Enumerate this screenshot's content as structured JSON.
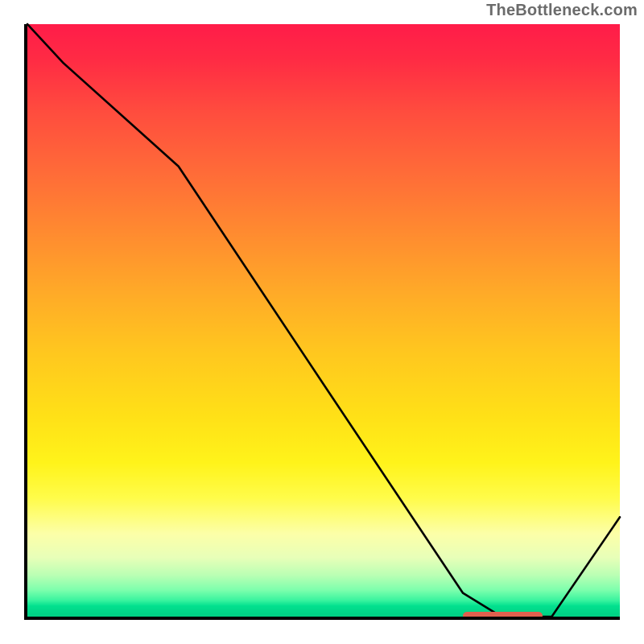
{
  "watermark": "TheBottleneck.com",
  "chart_data": {
    "type": "line",
    "title": "",
    "xlabel": "",
    "ylabel": "",
    "x": [
      0.0,
      0.06,
      0.255,
      0.5,
      0.735,
      0.8,
      0.885,
      1.0
    ],
    "values": [
      1.0,
      0.935,
      0.76,
      0.392,
      0.04,
      0.0,
      0.0,
      0.168
    ],
    "xlim": [
      0,
      1
    ],
    "ylim": [
      0,
      1
    ],
    "optimal_band": {
      "start": 0.735,
      "end": 0.87,
      "y": 0.0
    },
    "gradient": {
      "top_color": "#ff1c49",
      "mid_color": "#ffe017",
      "bottom_color": "#00d084"
    }
  }
}
